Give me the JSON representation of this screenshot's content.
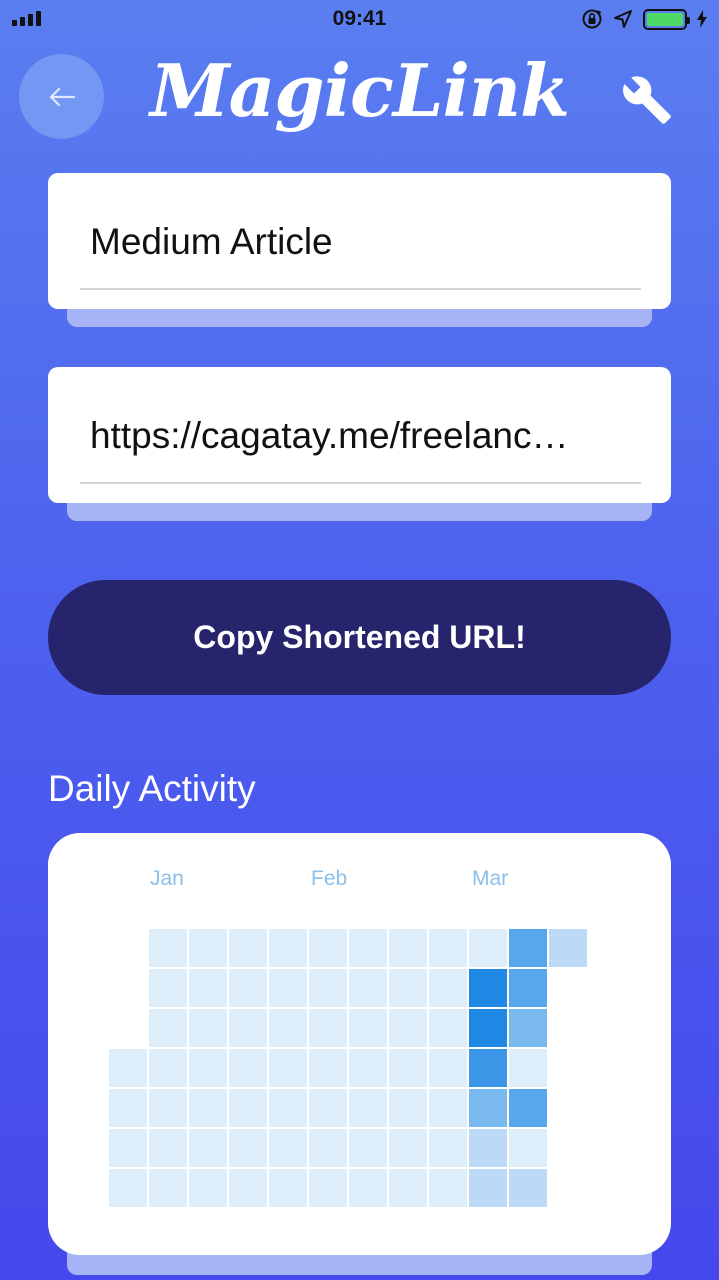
{
  "status_bar": {
    "time": "09:41",
    "icons": [
      "signal-icon",
      "orientation-lock-icon",
      "location-icon",
      "battery-icon",
      "charging-icon"
    ],
    "battery_color": "#4cd964"
  },
  "header": {
    "logo_text": "MagicLink",
    "back_icon": "arrow-left-icon",
    "settings_icon": "wrench-icon"
  },
  "form": {
    "title_value": "Medium Article",
    "url_value": "https://cagatay.me/freelanc…",
    "copy_button_label": "Copy Shortened URL!"
  },
  "activity": {
    "title": "Daily Activity",
    "months": [
      "Jan",
      "Feb",
      "Mar"
    ],
    "colors": {
      "0": "#ddedf9",
      "1": "#bcdaf5",
      "2": "#7ab9ed",
      "3": "#58a6ec",
      "4": "#3b96e8",
      "5": "#1f88e5"
    },
    "weeks": [
      [
        null,
        null,
        null,
        0,
        0,
        0,
        0
      ],
      [
        0,
        0,
        0,
        0,
        0,
        0,
        0
      ],
      [
        0,
        0,
        0,
        0,
        0,
        0,
        0
      ],
      [
        0,
        0,
        0,
        0,
        0,
        0,
        0
      ],
      [
        0,
        0,
        0,
        0,
        0,
        0,
        0
      ],
      [
        0,
        0,
        0,
        0,
        0,
        0,
        0
      ],
      [
        0,
        0,
        0,
        0,
        0,
        0,
        0
      ],
      [
        0,
        0,
        0,
        0,
        0,
        0,
        0
      ],
      [
        0,
        0,
        0,
        0,
        0,
        0,
        0
      ],
      [
        0,
        5,
        5,
        4,
        2,
        1,
        1
      ],
      [
        3,
        3,
        2,
        0,
        3,
        0,
        1
      ],
      [
        1,
        null,
        null,
        null,
        null,
        null,
        null
      ]
    ]
  }
}
